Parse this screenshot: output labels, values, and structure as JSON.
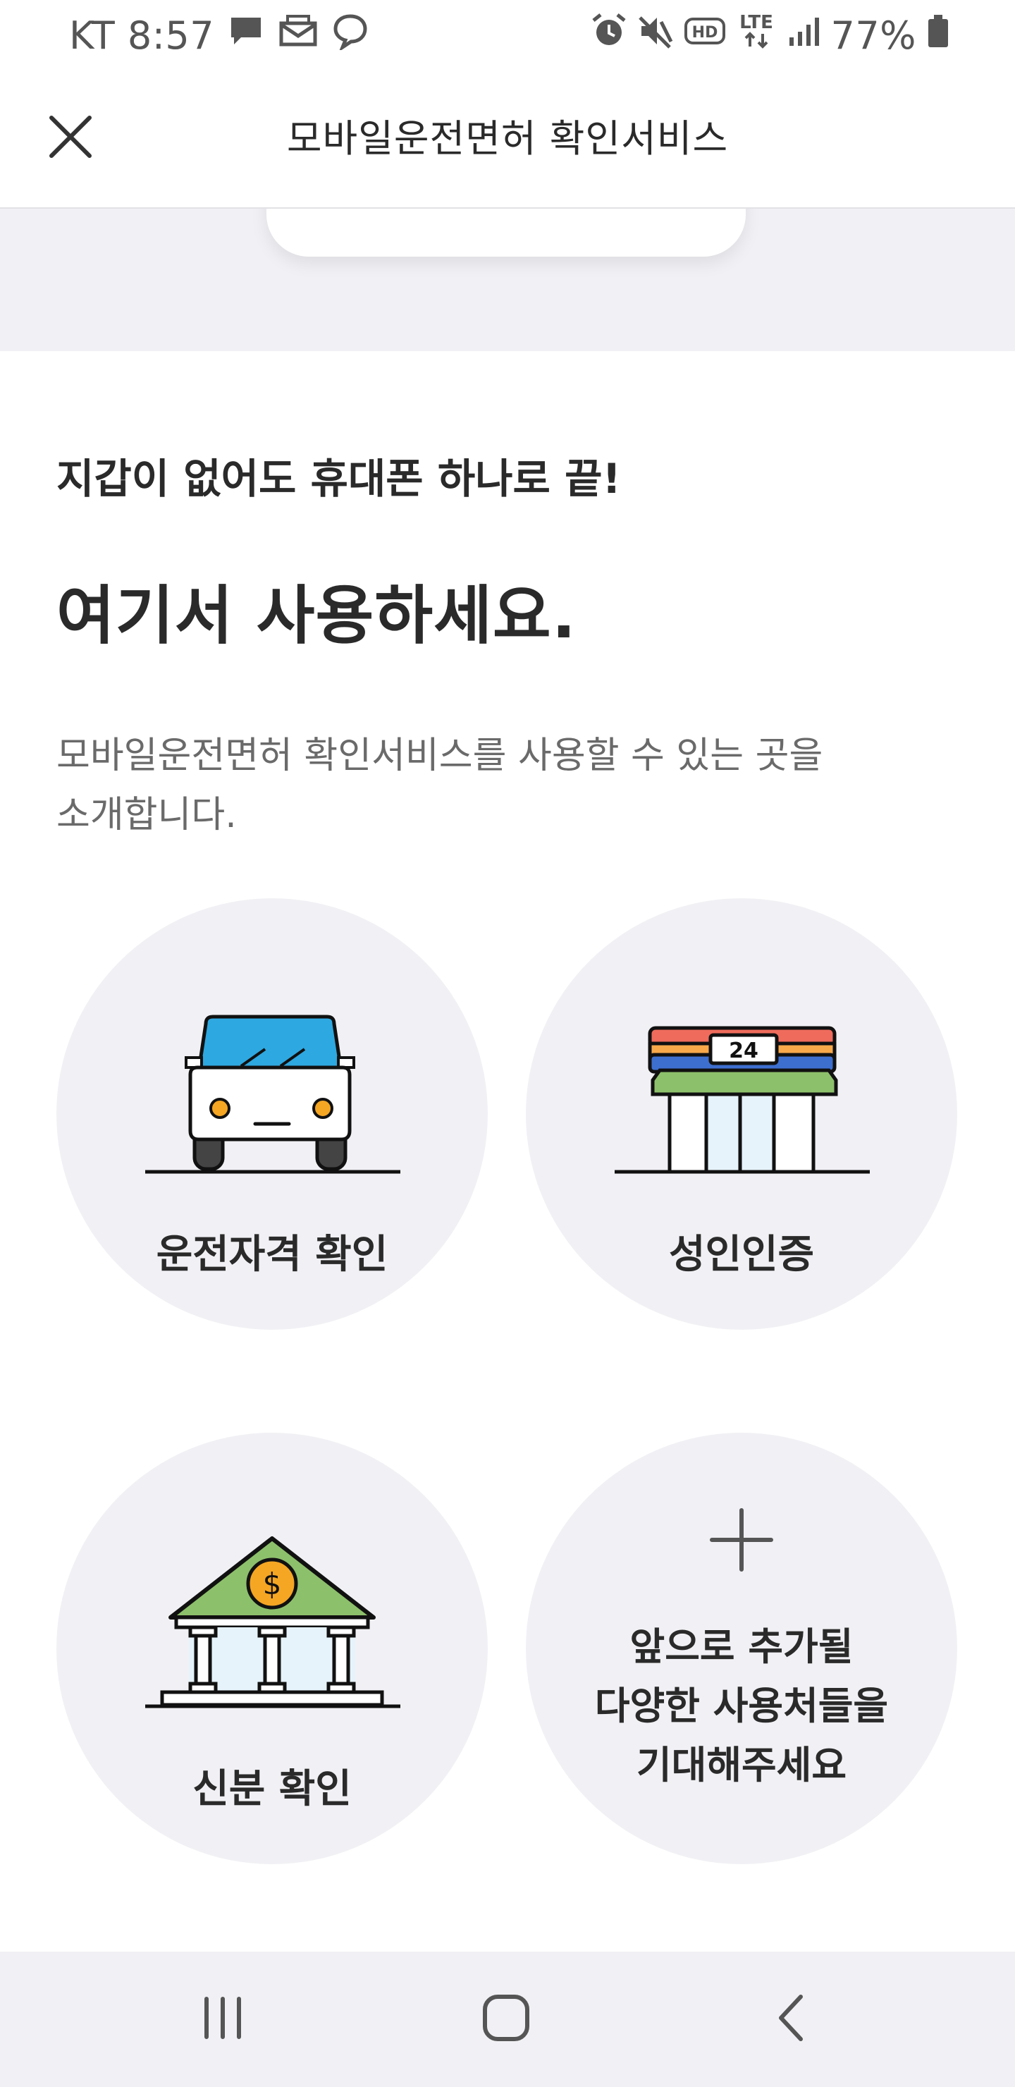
{
  "status_bar": {
    "carrier_time": "KT 8:57",
    "icons": [
      "chat-icon",
      "mail-icon",
      "messenger-icon",
      "alarm-icon",
      "mute-icon",
      "hd-icon",
      "lte-icon",
      "signal-icon",
      "battery-icon"
    ],
    "hd_label": "HD",
    "lte_label": "LTE",
    "battery_percent": "77%"
  },
  "app_bar": {
    "title": "모바일운전면허 확인서비스",
    "close_icon": "close-icon"
  },
  "intro": {
    "subtitle": "지갑이 없어도 휴대폰 하나로 끝!",
    "title": "여기서 사용하세요.",
    "description_line1": "모바일운전면허 확인서비스를 사용할 수 있는 곳을",
    "description_line2": "소개합니다."
  },
  "tiles": [
    {
      "label": "운전자격 확인",
      "icon": "car-icon"
    },
    {
      "label": "성인인증",
      "icon": "convenience-store-icon",
      "store_sign": "24"
    },
    {
      "label": "신분 확인",
      "icon": "bank-icon",
      "bank_symbol": "$"
    },
    {
      "icon": "plus-icon",
      "lines": [
        "앞으로 추가될",
        "다양한 사용처들을",
        "기대해주세요"
      ]
    }
  ],
  "colors": {
    "car_blue": "#2ea8e0",
    "orange": "#f5a623",
    "store_red": "#ef6b5b",
    "store_orange": "#f8a94a",
    "store_blue": "#3d6fcf",
    "green": "#8dc06b",
    "glass": "#e6f3fb",
    "tile_bg": "#f1f1f5"
  },
  "nav_bar": {
    "icons": [
      "recent-apps-icon",
      "home-icon",
      "back-icon"
    ]
  }
}
